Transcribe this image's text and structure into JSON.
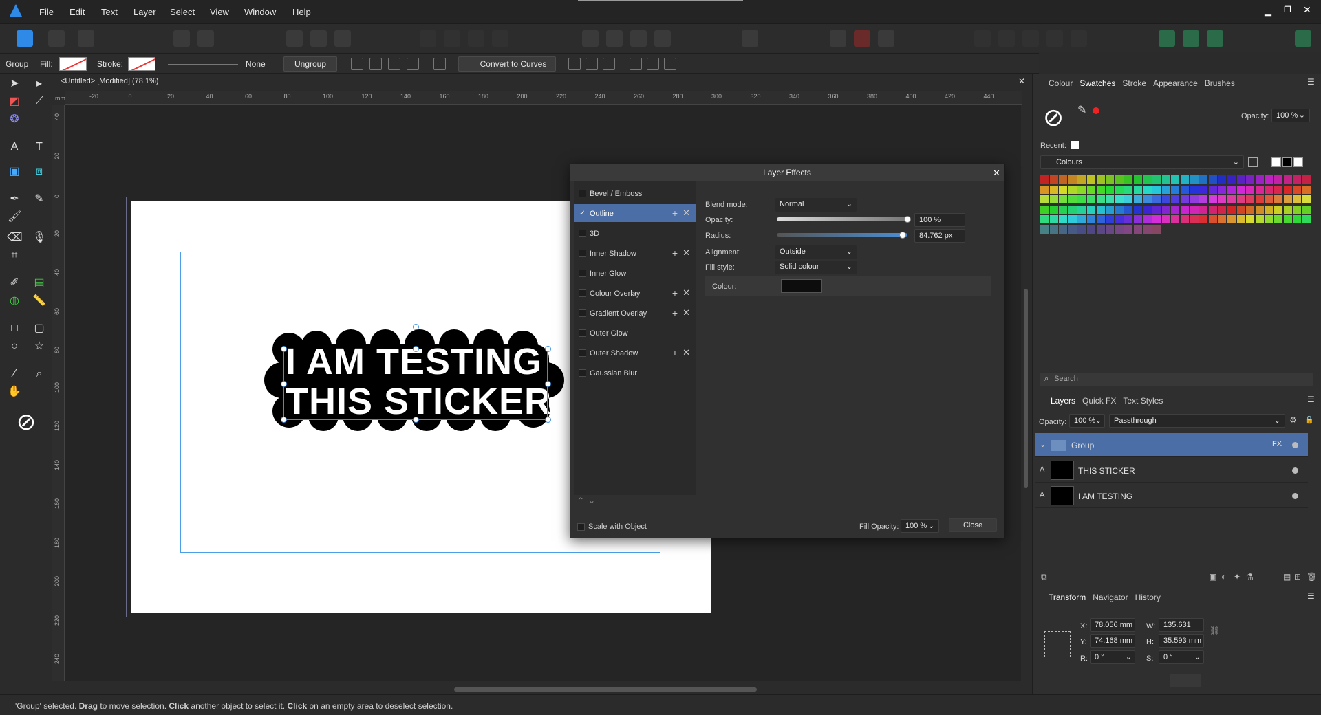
{
  "menu": [
    "File",
    "Edit",
    "Text",
    "Layer",
    "Select",
    "View",
    "Window",
    "Help"
  ],
  "context": {
    "selection": "Group",
    "fill_label": "Fill:",
    "stroke_label": "Stroke:",
    "stroke_style": "None",
    "ungroup": "Ungroup",
    "convert": "Convert to Curves"
  },
  "document": {
    "title": "<Untitled> [Modified] (78.1%)",
    "ruler_unit": "mm",
    "h_ticks": [
      "-20",
      "0",
      "20",
      "40",
      "60",
      "80",
      "100",
      "120",
      "140",
      "160",
      "180",
      "200",
      "220",
      "240",
      "260",
      "280",
      "300",
      "320",
      "340",
      "360",
      "380",
      "400",
      "420",
      "440"
    ],
    "v_ticks": [
      "40",
      "20",
      "0",
      "20",
      "40",
      "60",
      "80",
      "100",
      "120",
      "140",
      "160",
      "180",
      "200",
      "220",
      "240"
    ]
  },
  "sticker": {
    "line1": "I AM TESTING",
    "line2": "THIS STICKER"
  },
  "status": {
    "pre": "'Group' selected. ",
    "b1": "Drag",
    "t1": " to move selection. ",
    "b2": "Click",
    "t2": " another object to select it. ",
    "b3": "Click",
    "t3": " on an empty area to deselect selection."
  },
  "dialog": {
    "title": "Layer Effects",
    "effects": [
      {
        "label": "Bevel / Emboss",
        "checked": false,
        "plus": false
      },
      {
        "label": "Outline",
        "checked": true,
        "plus": true
      },
      {
        "label": "3D",
        "checked": false,
        "plus": false
      },
      {
        "label": "Inner Shadow",
        "checked": false,
        "plus": true
      },
      {
        "label": "Inner Glow",
        "checked": false,
        "plus": false
      },
      {
        "label": "Colour Overlay",
        "checked": false,
        "plus": true
      },
      {
        "label": "Gradient Overlay",
        "checked": false,
        "plus": true
      },
      {
        "label": "Outer Glow",
        "checked": false,
        "plus": false
      },
      {
        "label": "Outer Shadow",
        "checked": false,
        "plus": true
      },
      {
        "label": "Gaussian Blur",
        "checked": false,
        "plus": false
      }
    ],
    "blend_mode_label": "Blend mode:",
    "blend_mode": "Normal",
    "opacity_label": "Opacity:",
    "opacity": "100 %",
    "opacity_level": 1.0,
    "radius_label": "Radius:",
    "radius": "84.762 px",
    "radius_level": 0.98,
    "alignment_label": "Alignment:",
    "alignment": "Outside",
    "fill_style_label": "Fill style:",
    "fill_style": "Solid colour",
    "colour_label": "Colour:",
    "colour_value": "#0d0d0d",
    "scale_label": "Scale with Object",
    "fill_opacity_label": "Fill Opacity:",
    "fill_opacity": "100 %",
    "close": "Close"
  },
  "panel": {
    "tabs": [
      "Colour",
      "Swatches",
      "Stroke",
      "Appearance",
      "Brushes"
    ],
    "active_tab": "Swatches",
    "opacity_label": "Opacity:",
    "opacity": "100 %",
    "recent_label": "Recent:",
    "palette": "Colours",
    "search_placeholder": "Search",
    "layer_tabs": [
      "Layers",
      "Quick FX",
      "Text Styles"
    ],
    "layer_opacity_label": "Opacity:",
    "layer_opacity": "100 %",
    "blend": "Passthrough",
    "layers": [
      {
        "name": "Group",
        "selected": true,
        "fx": "FX"
      },
      {
        "name": "THIS STICKER",
        "selected": false,
        "fx": ""
      },
      {
        "name": "I AM TESTING",
        "selected": false,
        "fx": ""
      }
    ],
    "transform_tabs": [
      "Transform",
      "Navigator",
      "History"
    ],
    "x_label": "X:",
    "x": "78.056 mm",
    "y_label": "Y:",
    "y": "74.168 mm",
    "w_label": "W:",
    "w": "135.631 mm",
    "h_label": "H:",
    "h": "35.593 mm",
    "r_label": "R:",
    "r": "0 °",
    "s_label": "S:",
    "s": "0 °"
  },
  "colors": {
    "accent": "#4a6ea5",
    "selection": "#4a9fe6",
    "sticker_bg": "#000000"
  }
}
